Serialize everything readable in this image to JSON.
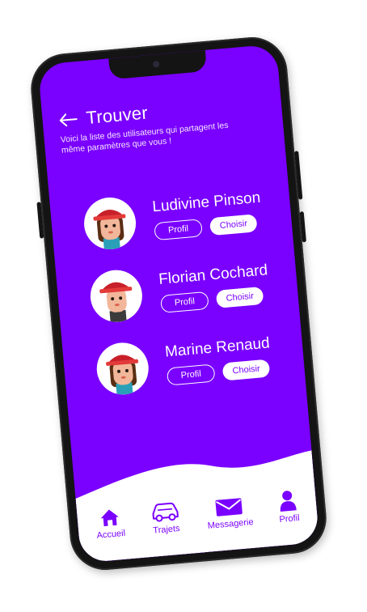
{
  "header": {
    "title": "Trouver",
    "subtitle": "Voici la liste des utilisateurs qui partagent les même paramètres que vous !"
  },
  "users": [
    {
      "name": "Ludivine Pinson",
      "profil_label": "Profil",
      "choisir_label": "Choisir"
    },
    {
      "name": "Florian Cochard",
      "profil_label": "Profil",
      "choisir_label": "Choisir"
    },
    {
      "name": "Marine Renaud",
      "profil_label": "Profil",
      "choisir_label": "Choisir"
    }
  ],
  "nav": [
    {
      "label": "Accueil",
      "icon": "home-icon"
    },
    {
      "label": "Trajets",
      "icon": "car-icon"
    },
    {
      "label": "Messagerie",
      "icon": "envelope-icon"
    },
    {
      "label": "Profil",
      "icon": "person-icon"
    }
  ],
  "colors": {
    "accent": "#7a00ff",
    "background": "#ffffff",
    "phone_frame": "#141414"
  }
}
